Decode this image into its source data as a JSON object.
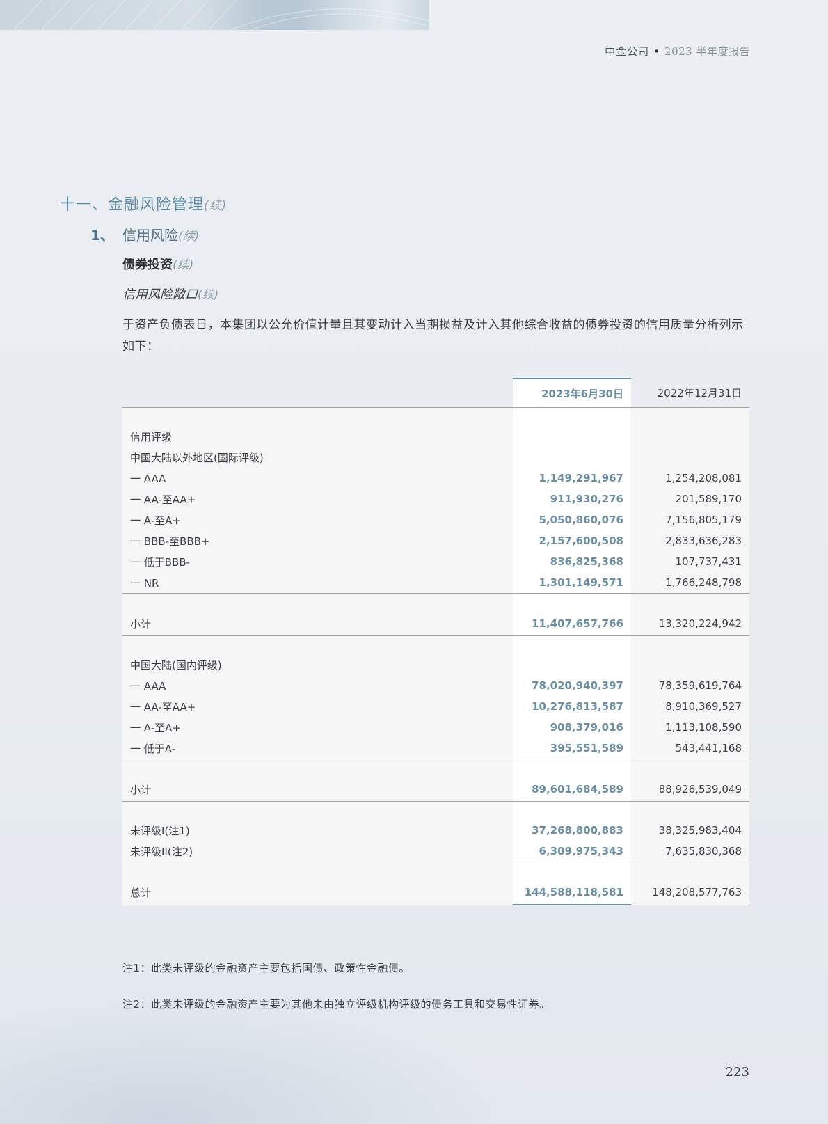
{
  "header": {
    "company": "中金公司",
    "separator": "•",
    "report": "2023 半年度报告"
  },
  "section": {
    "title": "十一、金融风险管理",
    "cont": "(续)"
  },
  "subsection": {
    "num": "1、",
    "title": "信用风险",
    "cont": "(续)"
  },
  "subsubsection": {
    "title": "债券投资",
    "cont": "(续)"
  },
  "subsubsubsection": {
    "title": "信用风险敞口",
    "cont": "(续)"
  },
  "paragraph": "于资产负债表日，本集团以公允价值计量且其变动计入当期损益及计入其他综合收益的债券投资的信用质量分析列示如下：",
  "table": {
    "col1": "2023年6月30日",
    "col2": "2022年12月31日",
    "label_credit": "信用评级",
    "label_overseas": "中国大陆以外地区(国际评级)",
    "overseas_rows": [
      {
        "label": "一 AAA",
        "v1": "1,149,291,967",
        "v2": "1,254,208,081"
      },
      {
        "label": "一 AA-至AA+",
        "v1": "911,930,276",
        "v2": "201,589,170"
      },
      {
        "label": "一 A-至A+",
        "v1": "5,050,860,076",
        "v2": "7,156,805,179"
      },
      {
        "label": "一 BBB-至BBB+",
        "v1": "2,157,600,508",
        "v2": "2,833,636,283"
      },
      {
        "label": "一 低于BBB-",
        "v1": "836,825,368",
        "v2": "107,737,431"
      },
      {
        "label": "一 NR",
        "v1": "1,301,149,571",
        "v2": "1,766,248,798"
      }
    ],
    "subtotal1": {
      "label": "小计",
      "v1": "11,407,657,766",
      "v2": "13,320,224,942"
    },
    "label_domestic": "中国大陆(国内评级)",
    "domestic_rows": [
      {
        "label": "一 AAA",
        "v1": "78,020,940,397",
        "v2": "78,359,619,764"
      },
      {
        "label": "一 AA-至AA+",
        "v1": "10,276,813,587",
        "v2": "8,910,369,527"
      },
      {
        "label": "一 A-至A+",
        "v1": "908,379,016",
        "v2": "1,113,108,590"
      },
      {
        "label": "一 低于A-",
        "v1": "395,551,589",
        "v2": "543,441,168"
      }
    ],
    "subtotal2": {
      "label": "小计",
      "v1": "89,601,684,589",
      "v2": "88,926,539,049"
    },
    "unrated_rows": [
      {
        "label": "未评级I(注1)",
        "v1": "37,268,800,883",
        "v2": "38,325,983,404"
      },
      {
        "label": "未评级II(注2)",
        "v1": "6,309,975,343",
        "v2": "7,635,830,368"
      }
    ],
    "total": {
      "label": "总计",
      "v1": "144,588,118,581",
      "v2": "148,208,577,763"
    }
  },
  "notes": {
    "n1": "注1：此类未评级的金融资产主要包括国债、政策性金融债。",
    "n2": "注2：此类未评级的金融资产主要为其他未由独立评级机构评级的债务工具和交易性证券。"
  },
  "page_number": "223"
}
